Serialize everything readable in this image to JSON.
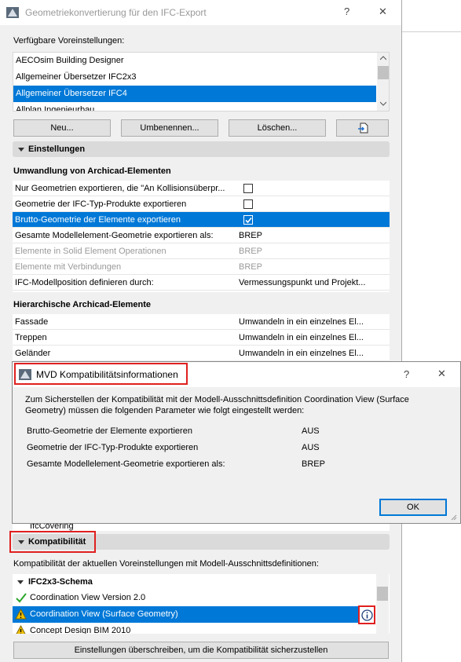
{
  "main_window": {
    "title": "Geometriekonvertierung für den IFC-Export",
    "help_label": "?",
    "close_label": "✕"
  },
  "presets": {
    "label": "Verfügbare Voreinstellungen:",
    "items": [
      "AECOsim Building Designer",
      "Allgemeiner Übersetzer IFC2x3",
      "Allgemeiner Übersetzer IFC4",
      "Allplan Ingenieurbau"
    ],
    "selected_index": 2,
    "buttons": {
      "new": "Neu...",
      "rename": "Umbenennen...",
      "delete": "Löschen..."
    }
  },
  "settings": {
    "header": "Einstellungen",
    "conversion_title": "Umwandlung von Archicad-Elementen",
    "rows": [
      {
        "label": "Nur Geometrien exportieren, die \"An Kollisionsüberpr...",
        "value": "",
        "checkbox": true,
        "checked": false
      },
      {
        "label": "Geometrie der IFC-Typ-Produkte exportieren",
        "value": "",
        "checkbox": true,
        "checked": false
      },
      {
        "label": "Brutto-Geometrie der Elemente exportieren",
        "value": "",
        "checkbox": true,
        "checked": true
      },
      {
        "label": "Gesamte Modellelement-Geometrie exportieren als:",
        "value": "BREP"
      },
      {
        "label": "Elemente in Solid Element Operationen",
        "value": "BREP",
        "disabled": true
      },
      {
        "label": "Elemente mit Verbindungen",
        "value": "BREP",
        "disabled": true
      },
      {
        "label": "IFC-Modellposition definieren durch:",
        "value": "Vermessungspunkt und Projekt..."
      }
    ],
    "hierarchy_title": "Hierarchische Archicad-Elemente",
    "hierarchy_rows": [
      {
        "label": "Fassade",
        "value": "Umwandeln in ein einzelnes El..."
      },
      {
        "label": "Treppen",
        "value": "Umwandeln in ein einzelnes El..."
      },
      {
        "label": "Geländer",
        "value": "Umwandeln in ein einzelnes El..."
      }
    ],
    "partial_row": "IfcCovering"
  },
  "compat": {
    "header": "Kompatibilität",
    "desc": "Kompatibilität der aktuellen Voreinstellungen mit Modell-Ausschnittsdefinitionen:",
    "schema": "IFC2x3-Schema",
    "items": [
      {
        "label": "Coordination View Version 2.0",
        "status": "ok"
      },
      {
        "label": "Coordination View (Surface Geometry)",
        "status": "warn"
      },
      {
        "label": "Concept Design BIM 2010",
        "status": "warn"
      }
    ],
    "override_button": "Einstellungen überschreiben, um die Kompatibilität sicherzustellen"
  },
  "mvd_dialog": {
    "title": "MVD Kompatibilitätsinformationen",
    "help_label": "?",
    "close_label": "✕",
    "message": "Zum Sicherstellen der Kompatibilität mit der Modell-Ausschnittsdefinition Coordination View (Surface Geometry) müssen die folgenden Parameter wie folgt eingestellt werden:",
    "params": [
      {
        "label": "Brutto-Geometrie der Elemente exportieren",
        "value": "AUS"
      },
      {
        "label": "Geometrie der IFC-Typ-Produkte exportieren",
        "value": "AUS"
      },
      {
        "label": "Gesamte Modellelement-Geometrie exportieren als:",
        "value": "BREP"
      }
    ],
    "ok_label": "OK"
  },
  "colors": {
    "selection": "#0078d7",
    "highlight_box": "#e02020",
    "warning": "#f2c200",
    "ok_check": "#2aa52a"
  }
}
